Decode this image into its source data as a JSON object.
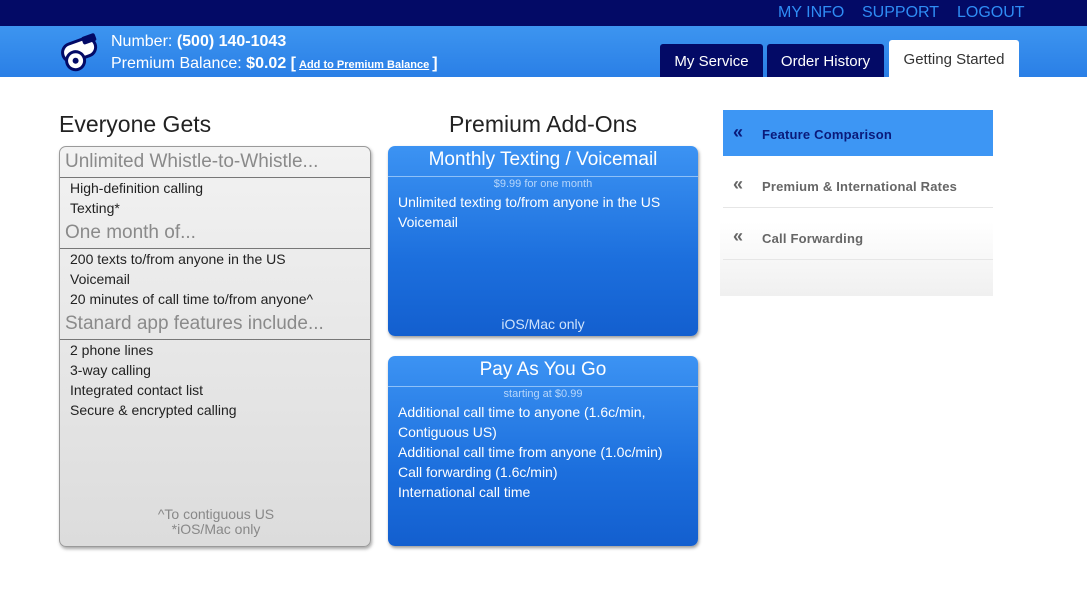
{
  "topnav": {
    "my_info": "MY INFO",
    "support": "SUPPORT",
    "logout": "LOGOUT"
  },
  "account": {
    "number_label": "Number:",
    "number_value": "(500) 140-1043",
    "balance_label": "Premium Balance:",
    "balance_value": "$0.02",
    "bracket_open": "[",
    "add_link": "Add to Premium Balance",
    "bracket_close": "]"
  },
  "tabs": [
    {
      "label": "My Service"
    },
    {
      "label": "Order History"
    },
    {
      "label": "Getting Started",
      "active": true
    }
  ],
  "everyone": {
    "title": "Everyone Gets",
    "sections": [
      {
        "heading": "Unlimited Whistle-to-Whistle...",
        "items": [
          "High-definition calling",
          "Texting*"
        ]
      },
      {
        "heading": "One month of...",
        "items": [
          "200 texts to/from anyone in the US",
          "Voicemail",
          "20 minutes of call time to/from anyone^"
        ]
      },
      {
        "heading": "Stanard app features include...",
        "items": [
          "2 phone lines",
          "3-way calling",
          "Integrated contact list",
          "Secure & encrypted calling"
        ]
      }
    ],
    "footnotes": [
      "^To contiguous US",
      "*iOS/Mac only"
    ]
  },
  "premium": {
    "title": "Premium Add-Ons",
    "addons": [
      {
        "title": "Monthly Texting / Voicemail",
        "price": "$9.99 for one month",
        "lines": [
          "Unlimited texting to/from anyone in the US",
          "Voicemail"
        ],
        "footer": "iOS/Mac only"
      },
      {
        "title": "Pay As You Go",
        "price": "starting at $0.99",
        "lines": [
          "Additional call time to anyone (1.6c/min,",
          "Contiguous US)",
          "Additional call time from anyone (1.0c/min)",
          "Call forwarding (1.6c/min)",
          "International call time"
        ]
      }
    ]
  },
  "sidebar": {
    "items": [
      {
        "label": "Feature Comparison",
        "active": true,
        "icon": "double-chevron-left-icon",
        "glyph": "«"
      },
      {
        "label": "Premium & International Rates",
        "icon": "double-chevron-left-icon",
        "glyph": "«"
      },
      {
        "label": "Call Forwarding",
        "icon": "double-chevron-left-icon",
        "glyph": "«"
      }
    ]
  },
  "colors": {
    "nav_dark": "#030a66",
    "header_blue": "#2a7fe6",
    "link_blue": "#2f8df5",
    "active_side": "#3d96f4"
  }
}
